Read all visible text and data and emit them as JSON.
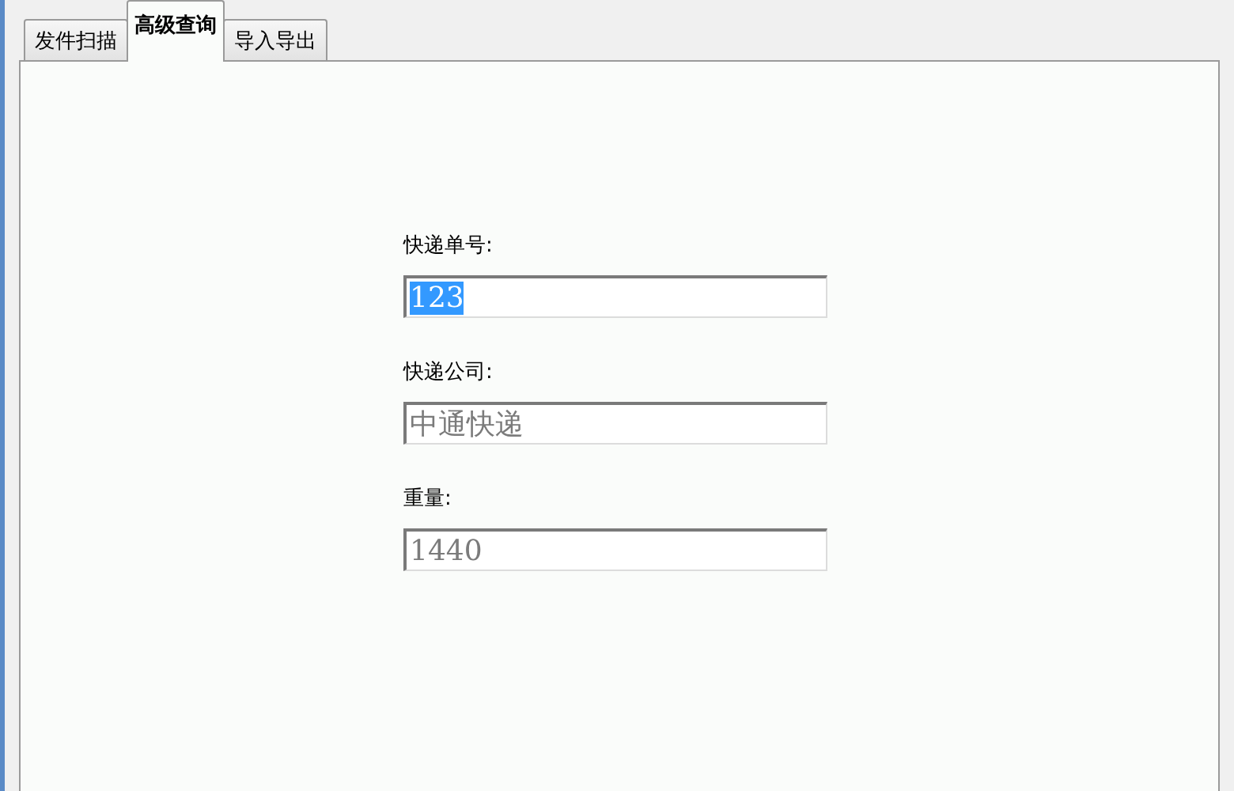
{
  "tabs": [
    {
      "label": "发件扫描",
      "selected": false
    },
    {
      "label": "高级查询",
      "selected": true
    },
    {
      "label": "导入导出",
      "selected": false
    }
  ],
  "fields": [
    {
      "label": "快递单号:",
      "value": "123",
      "highlighted": true,
      "disabled": false
    },
    {
      "label": "快递公司:",
      "value": "中通快递",
      "highlighted": false,
      "disabled": true
    },
    {
      "label": "重量:",
      "value": "1440",
      "highlighted": false,
      "disabled": true
    }
  ]
}
